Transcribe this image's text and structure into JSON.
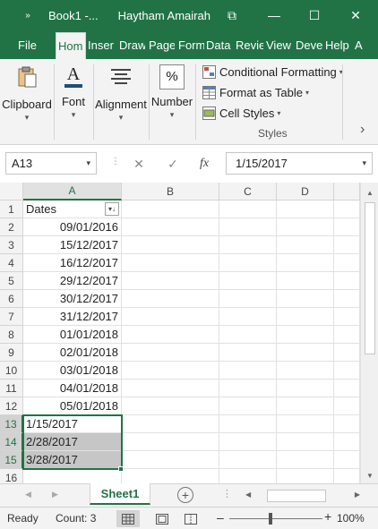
{
  "titlebar": {
    "quick_access": "»",
    "book": "Book1  -...",
    "user": "Haytham Amairah",
    "restore_glyph": "⧉",
    "minimize_glyph": "—",
    "maximize_glyph": "☐",
    "close_glyph": "✕"
  },
  "ribbon_tabs": [
    {
      "label": "File"
    },
    {
      "label": "Hom"
    },
    {
      "label": "Inser"
    },
    {
      "label": "Draw"
    },
    {
      "label": "Page"
    },
    {
      "label": "Form"
    },
    {
      "label": "Data"
    },
    {
      "label": "Revie"
    },
    {
      "label": "View"
    },
    {
      "label": "Deve"
    },
    {
      "label": "Help"
    },
    {
      "label": "A"
    }
  ],
  "ribbon": {
    "clipboard": "Clipboard",
    "font": "Font",
    "alignment": "Alignment",
    "number": "Number",
    "number_glyph": "%",
    "font_glyph": "A",
    "conditional_formatting": "Conditional Formatting",
    "format_as_table": "Format as Table",
    "cell_styles": "Cell Styles",
    "styles_group": "Styles",
    "expand_glyph": "›"
  },
  "formula_bar": {
    "name_box": "A13",
    "cancel_glyph": "✕",
    "enter_glyph": "✓",
    "fx_glyph": "fx",
    "value": "1/15/2017"
  },
  "grid": {
    "columns": [
      "A",
      "B",
      "C",
      "D"
    ],
    "rows": [
      {
        "num": "1",
        "a": "Dates"
      },
      {
        "num": "2",
        "a": "09/01/2016"
      },
      {
        "num": "3",
        "a": "15/12/2017"
      },
      {
        "num": "4",
        "a": "16/12/2017"
      },
      {
        "num": "5",
        "a": "29/12/2017"
      },
      {
        "num": "6",
        "a": "30/12/2017"
      },
      {
        "num": "7",
        "a": "31/12/2017"
      },
      {
        "num": "8",
        "a": "01/01/2018"
      },
      {
        "num": "9",
        "a": "02/01/2018"
      },
      {
        "num": "10",
        "a": "03/01/2018"
      },
      {
        "num": "11",
        "a": "04/01/2018"
      },
      {
        "num": "12",
        "a": "05/01/2018"
      },
      {
        "num": "13",
        "a": "1/15/2017"
      },
      {
        "num": "14",
        "a": "2/28/2017"
      },
      {
        "num": "15",
        "a": "3/28/2017"
      },
      {
        "num": "16",
        "a": ""
      }
    ]
  },
  "sheets": {
    "active": "Sheet1",
    "add_glyph": "+"
  },
  "status": {
    "ready": "Ready",
    "count": "Count: 3",
    "zoom_minus": "–",
    "zoom_plus": "+",
    "zoom": "100%",
    "zoom_level": 1.0
  },
  "colors": {
    "excel_green": "#217346",
    "ribbon_bg": "#f3f3f3",
    "selection_shade": "#c6c6c6"
  }
}
